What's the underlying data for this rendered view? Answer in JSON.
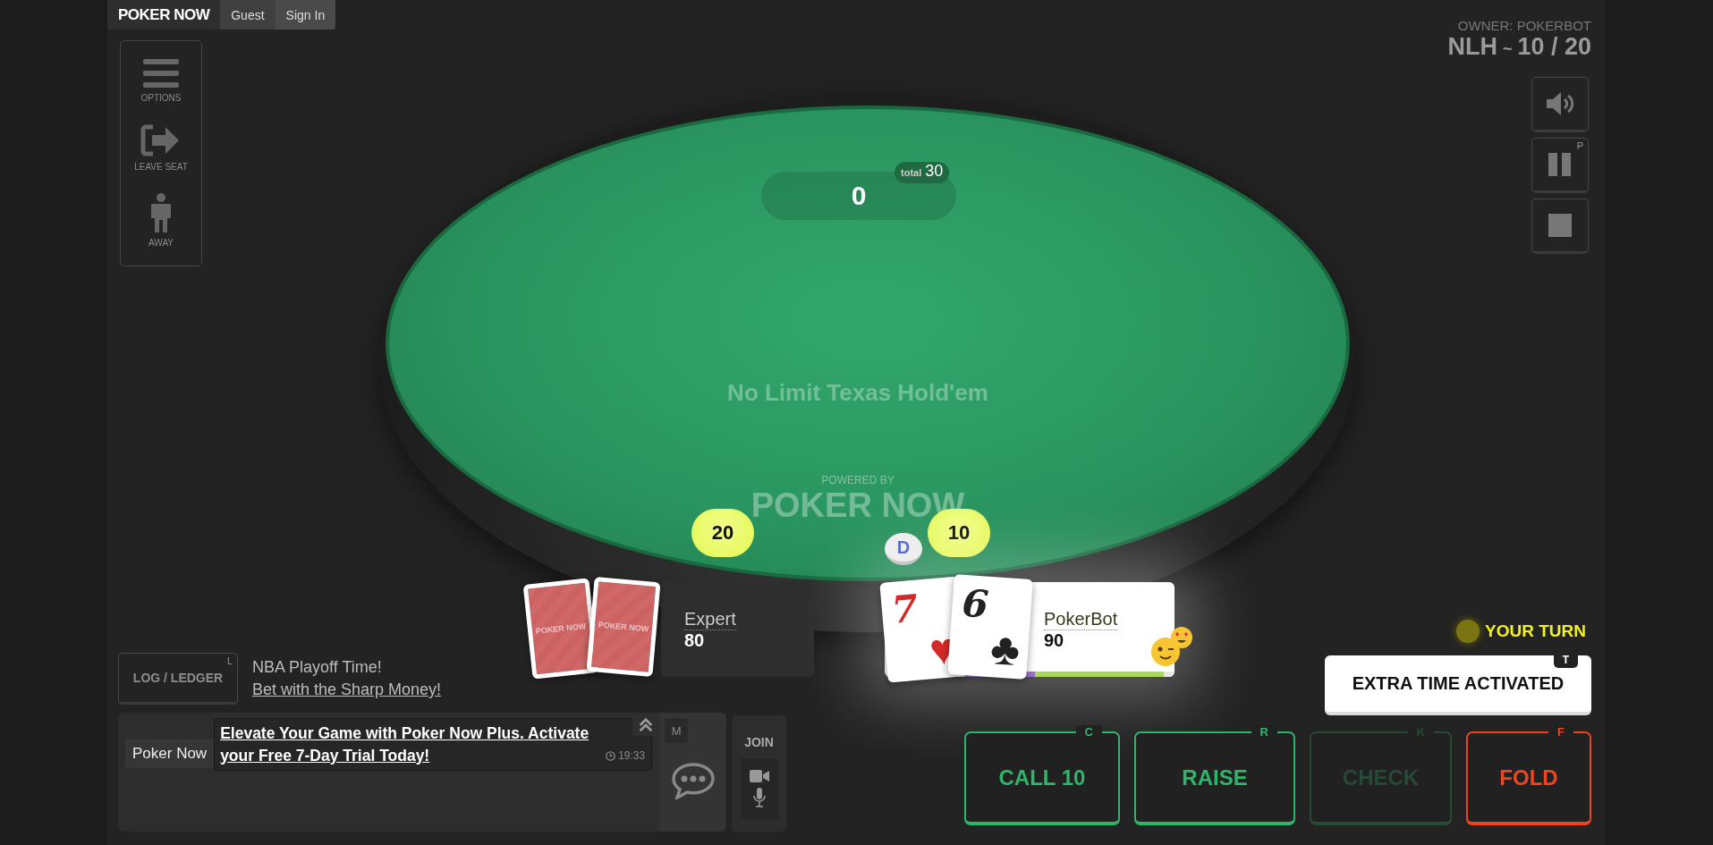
{
  "header": {
    "logo": "POKER NOW",
    "guest": "Guest",
    "sign_in": "Sign In"
  },
  "side_menu": [
    {
      "kind": "options",
      "label": "OPTIONS"
    },
    {
      "kind": "leave",
      "label": "LEAVE SEAT"
    },
    {
      "kind": "away",
      "label": "AWAY"
    }
  ],
  "game_info": {
    "owner": "OWNER: POKERBOT",
    "game": "NLH",
    "separator": "~",
    "blinds": "10 / 20"
  },
  "controls": [
    {
      "kind": "sound"
    },
    {
      "kind": "pause",
      "key": "P"
    },
    {
      "kind": "stop"
    }
  ],
  "table": {
    "pot": "0",
    "total_label": "total",
    "total": "30",
    "game_name": "No Limit Texas Hold'em",
    "powered_by": "POWERED BY",
    "brand": "POKER NOW",
    "dealer": "D"
  },
  "players": [
    {
      "name": "Expert",
      "stack": "80",
      "bet": "20",
      "highlighted": false,
      "cards": [
        {
          "kind": "back",
          "logo": "POKER NOW"
        },
        {
          "kind": "back",
          "logo": "POKER NOW"
        }
      ]
    },
    {
      "name": "PokerBot",
      "stack": "90",
      "bet": "10",
      "highlighted": true,
      "time_bar": {
        "level": 0.95
      },
      "cards": [
        {
          "kind": "face",
          "rank": "7",
          "suit": "♥",
          "color": "#d42a2a"
        },
        {
          "kind": "face",
          "rank": "6",
          "suit": "♣",
          "color": "#222222"
        }
      ]
    }
  ],
  "log": {
    "label": "LOG / LEDGER",
    "key": "L"
  },
  "ad": {
    "title": "NBA Playoff Time!",
    "link": "Bet with the Sharp Money!"
  },
  "chat": {
    "key": "M",
    "messages": [
      {
        "author": "Poker Now",
        "text": "Elevate Your Game with Poker Now Plus. Activate your Free 7-Day Trial Today!",
        "time": "19:33"
      }
    ]
  },
  "join": {
    "label": "JOIN"
  },
  "turn": {
    "label": "YOUR TURN"
  },
  "extra_time": {
    "label": "EXTRA TIME ACTIVATED",
    "key": "T"
  },
  "actions": [
    {
      "kind": "call",
      "label": "CALL 10",
      "key": "C",
      "disabled": false
    },
    {
      "kind": "raise",
      "label": "RAISE",
      "key": "R",
      "disabled": false
    },
    {
      "kind": "check",
      "label": "CHECK",
      "key": "K",
      "disabled": true
    },
    {
      "kind": "fold",
      "label": "FOLD",
      "key": "F",
      "disabled": false
    }
  ]
}
